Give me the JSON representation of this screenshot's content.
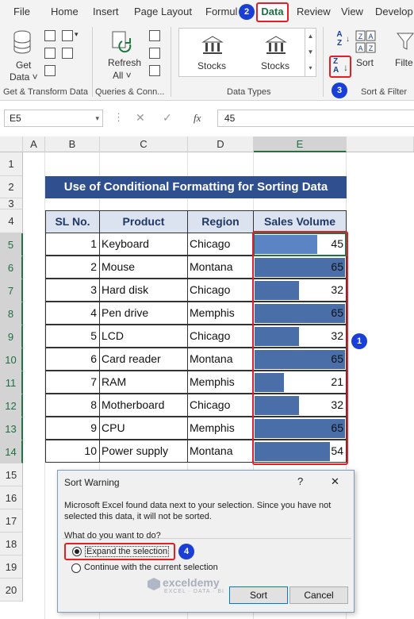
{
  "menu": {
    "tabs": [
      "File",
      "Home",
      "Insert",
      "Page Layout",
      "Formul",
      "Data",
      "Review",
      "View",
      "Develop"
    ],
    "active": "Data"
  },
  "badges": {
    "b1": "1",
    "b2": "2",
    "b3": "3",
    "b4": "4"
  },
  "ribbon": {
    "get_data": "Get",
    "get_data2": "Data ˅",
    "refresh": "Refresh",
    "refresh2": "All ˅",
    "stocks1": "Stocks",
    "stocks2": "Stocks",
    "sort": "Sort",
    "filter": "Filte",
    "groups": [
      "Get & Transform Data",
      "Queries & Conn...",
      "Data Types",
      "Sort & Filter"
    ]
  },
  "formula_bar": {
    "name_box": "E5",
    "value": "45",
    "fx": "fx"
  },
  "columns": [
    "A",
    "B",
    "C",
    "D",
    "E"
  ],
  "rows": [
    "1",
    "2",
    "3",
    "4",
    "5",
    "6",
    "7",
    "8",
    "9",
    "10",
    "11",
    "12",
    "13",
    "14",
    "15",
    "16",
    "17",
    "18",
    "19",
    "20"
  ],
  "sheet": {
    "title": "Use of Conditional Formatting for Sorting Data",
    "headers": [
      "SL No.",
      "Product",
      "Region",
      "Sales Volume"
    ],
    "records": [
      {
        "sl": "1",
        "product": "Keyboard",
        "region": "Chicago",
        "sales": 45,
        "sales_text": "45"
      },
      {
        "sl": "2",
        "product": "Mouse",
        "region": "Montana",
        "sales": 65,
        "sales_text": "65"
      },
      {
        "sl": "3",
        "product": "Hard disk",
        "region": "Chicago",
        "sales": 32,
        "sales_text": "32"
      },
      {
        "sl": "4",
        "product": "Pen drive",
        "region": "Memphis",
        "sales": 65,
        "sales_text": "65"
      },
      {
        "sl": "5",
        "product": "LCD",
        "region": "Chicago",
        "sales": 32,
        "sales_text": "32"
      },
      {
        "sl": "6",
        "product": "Card reader",
        "region": "Montana",
        "sales": 65,
        "sales_text": "65"
      },
      {
        "sl": "7",
        "product": "RAM",
        "region": "Memphis",
        "sales": 21,
        "sales_text": "21"
      },
      {
        "sl": "8",
        "product": "Motherboard",
        "region": "Chicago",
        "sales": 32,
        "sales_text": "32"
      },
      {
        "sl": "9",
        "product": "CPU",
        "region": "Memphis",
        "sales": 65,
        "sales_text": "65"
      },
      {
        "sl": "10",
        "product": "Power supply",
        "region": "Montana",
        "sales": 54,
        "sales_text": "54"
      }
    ],
    "max_sales": 65
  },
  "dialog": {
    "title": "Sort Warning",
    "help": "?",
    "close": "✕",
    "message": "Microsoft Excel found data next to your selection.  Since you have not selected this data, it will not be sorted.",
    "question": "What do you want to do?",
    "option1": "Expand the selection",
    "option2": "Continue with the current selection",
    "sort_button": "Sort",
    "cancel_button": "Cancel"
  },
  "watermark": {
    "name": "exceldemy",
    "tagline": "EXCEL · DATA · BI"
  },
  "colors": {
    "accent": "#217346",
    "bar": "#4a6ea8",
    "highlight": "#e21f26",
    "badge": "#1a3fd6",
    "banner": "#2f4f8f"
  }
}
